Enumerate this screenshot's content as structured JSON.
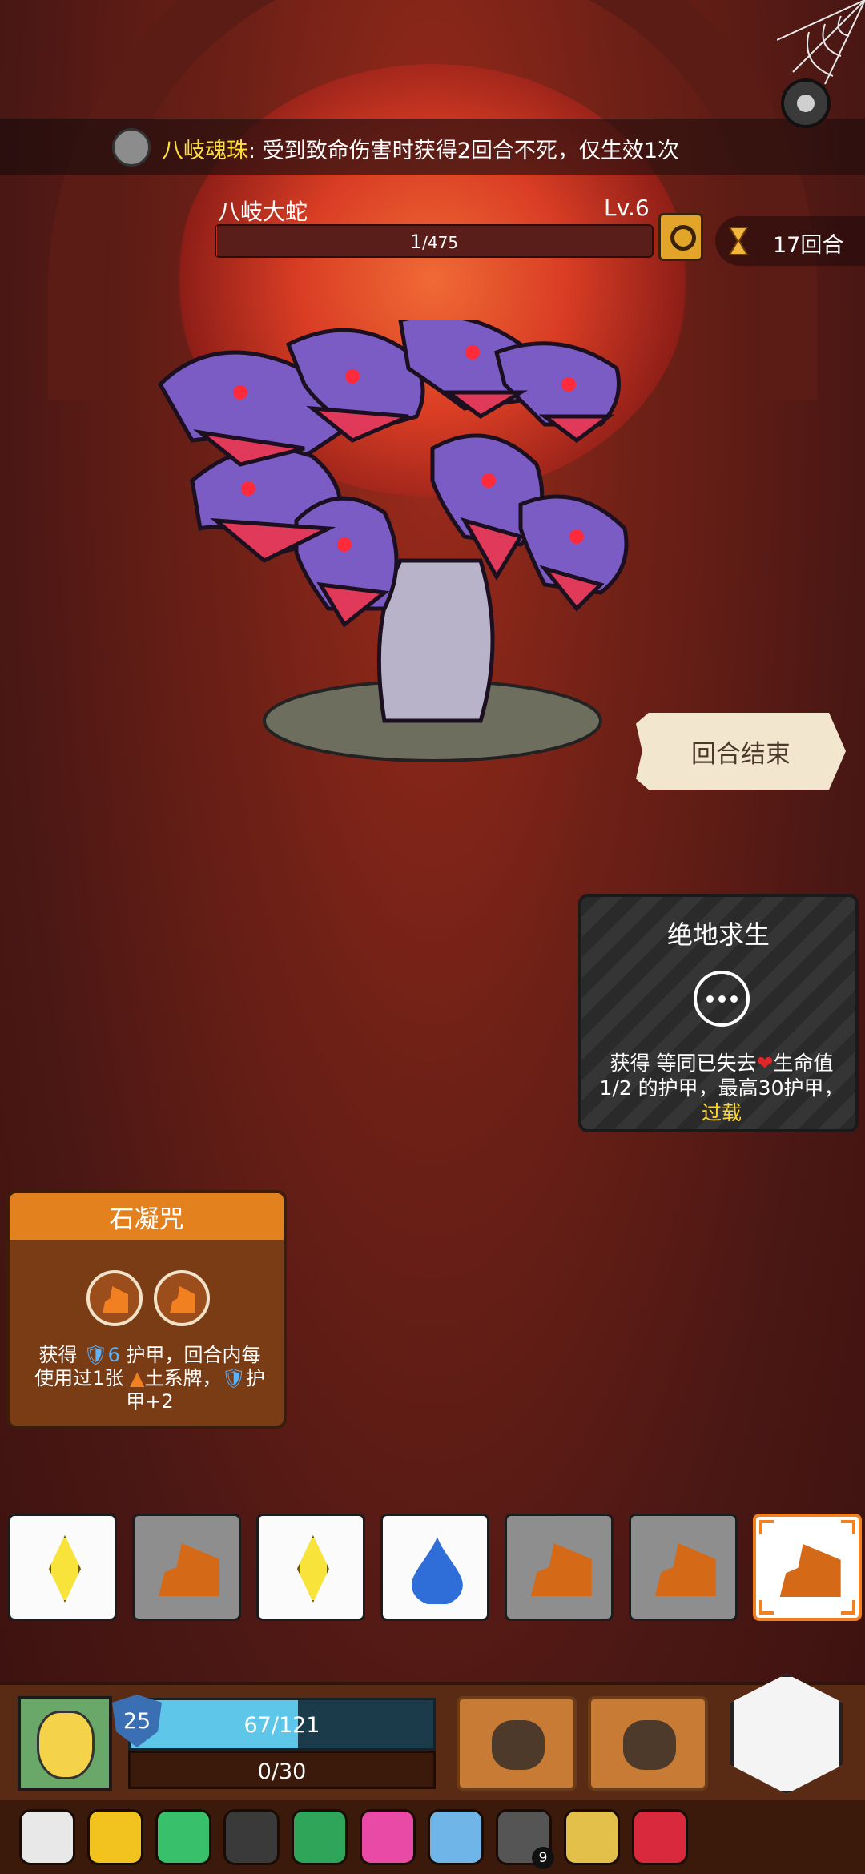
{
  "relic_banner": {
    "name": "八岐魂珠",
    "separator": ":",
    "effect": " 受到致命伤害时获得2回合不死，仅生效1次",
    "icon": "skull-relic-icon"
  },
  "enemy": {
    "name": "八岐大蛇",
    "level": "Lv.6",
    "hp_current": "1",
    "hp_max": "/475",
    "hp_fraction": 0.002,
    "intent_icon": "magnifier-intent-icon"
  },
  "turn": {
    "count_label": "17回合",
    "icon": "hourglass-icon"
  },
  "end_turn_label": "回合结束",
  "card_right": {
    "title": "绝地求生",
    "icon": "ellipsis-icon",
    "line1_a": "获得 等同已失去",
    "line1_heart": "❤",
    "line1_b": "生命值",
    "line2": "1/2 的护甲，最高30护甲，",
    "keyword": "过载"
  },
  "card_left": {
    "title": "石凝咒",
    "rune_icons": [
      "earth-rune-icon",
      "earth-rune-icon"
    ],
    "desc_a": "获得 ",
    "desc_num": "6",
    "desc_b": " 护甲，回合内每",
    "desc_c": "使用过1张 ",
    "desc_d": "土系牌，",
    "desc_e": "护",
    "desc_f": "甲+2"
  },
  "dice": [
    {
      "type": "light",
      "face": "white"
    },
    {
      "type": "earth",
      "face": "gray"
    },
    {
      "type": "light",
      "face": "white"
    },
    {
      "type": "water",
      "face": "white"
    },
    {
      "type": "earth",
      "face": "gray"
    },
    {
      "type": "earth",
      "face": "gray"
    },
    {
      "type": "earth",
      "face": "selected"
    }
  ],
  "player": {
    "armor": "25",
    "hp_label": "67/121",
    "hp_fraction": 0.554,
    "energy_label": "0/30"
  },
  "relics": [
    {
      "icon": "horned-skull-icon",
      "color": "#e8e8e8"
    },
    {
      "icon": "gold-box-icon",
      "color": "#f2c21e"
    },
    {
      "icon": "green-leaf-icon",
      "color": "#39c06a"
    },
    {
      "icon": "black-pot-icon",
      "color": "#3a3a3a"
    },
    {
      "icon": "emerald-icon",
      "color": "#2fa55a"
    },
    {
      "icon": "heart-charm-icon",
      "color": "#e84aa6"
    },
    {
      "icon": "blue-sword-icon",
      "color": "#6fb5e8"
    },
    {
      "icon": "dark-shield-icon",
      "color": "#555555",
      "count": "9"
    },
    {
      "icon": "banana-claw-icon",
      "color": "#e2c04a"
    },
    {
      "icon": "red-amulet-icon",
      "color": "#d82a3c"
    }
  ],
  "colors": {
    "accent_orange": "#f08020",
    "keyword_yellow": "#ffd52a",
    "hp_cyan": "#5ec6e8",
    "enemy_hp_red": "#c62b1f"
  }
}
